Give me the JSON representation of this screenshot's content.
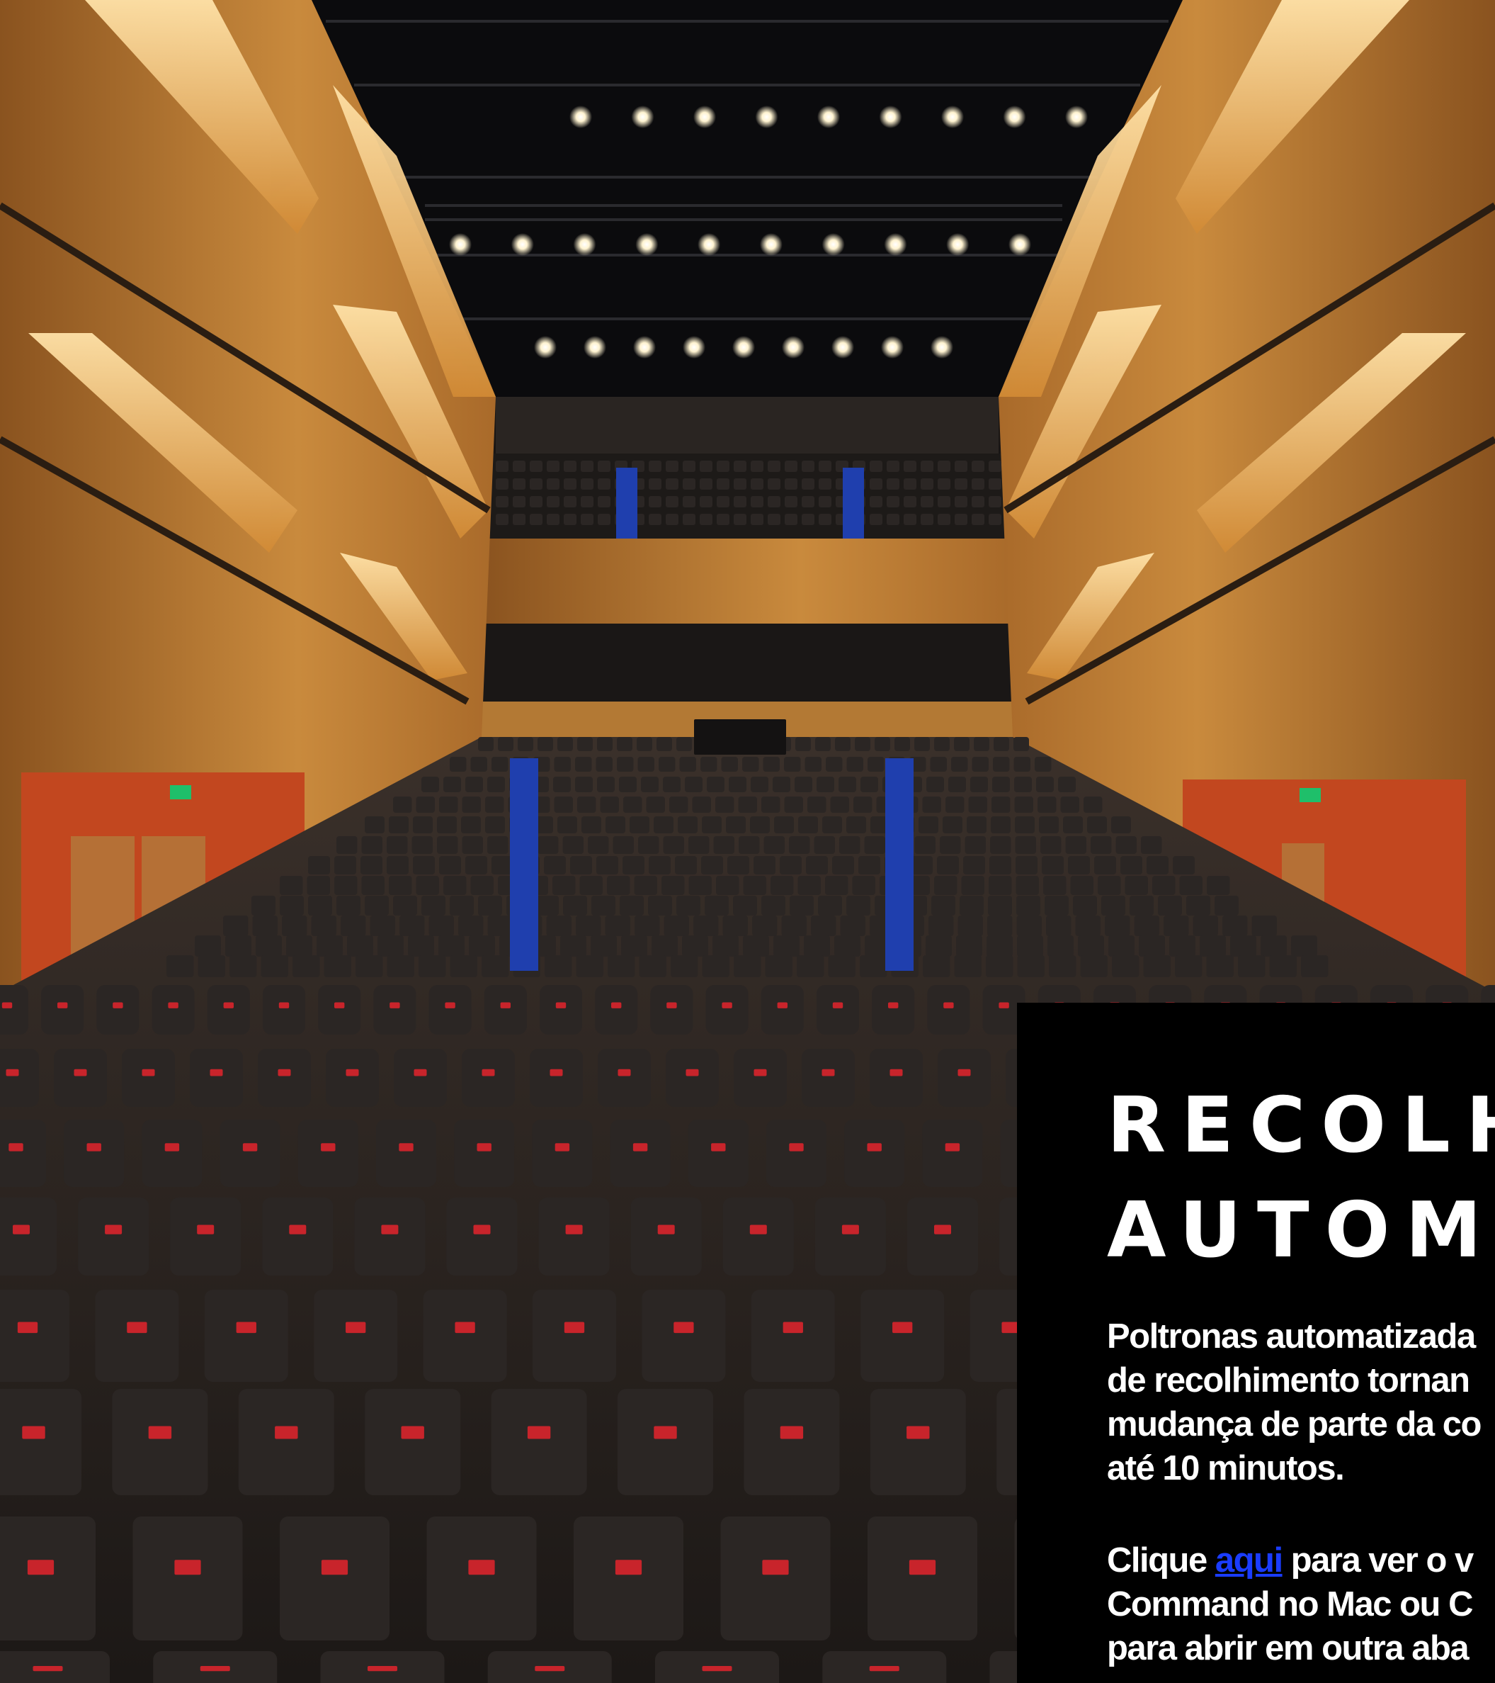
{
  "photo": {
    "description_icon": "theatre-auditorium-photo",
    "colors": {
      "wood": "#c5843a",
      "wood_dark": "#7a4a1e",
      "light_glow": "#ffd48a",
      "ceiling": "#0b0b0d",
      "seat": "#2b2624",
      "seat_dark": "#1a1615",
      "tag": "#c8242b",
      "door": "#c2471f",
      "aisle_blue": "#1f3fae",
      "exit_sign": "#1fbf6a"
    }
  },
  "panel": {
    "title_line1": "RECOLHI",
    "title_line2": "AUTOMÁ",
    "desc_line1": "Poltronas automatizada",
    "desc_line2": "de recolhimento tornan",
    "desc_line3": "mudança de parte da co",
    "desc_line4": "até 10 minutos.",
    "cta_prefix": "Clique ",
    "cta_link": "aqui",
    "cta_suffix": " para ver o v",
    "cta_line2": "Command no Mac ou C",
    "cta_line3": "para abrir em outra aba"
  }
}
